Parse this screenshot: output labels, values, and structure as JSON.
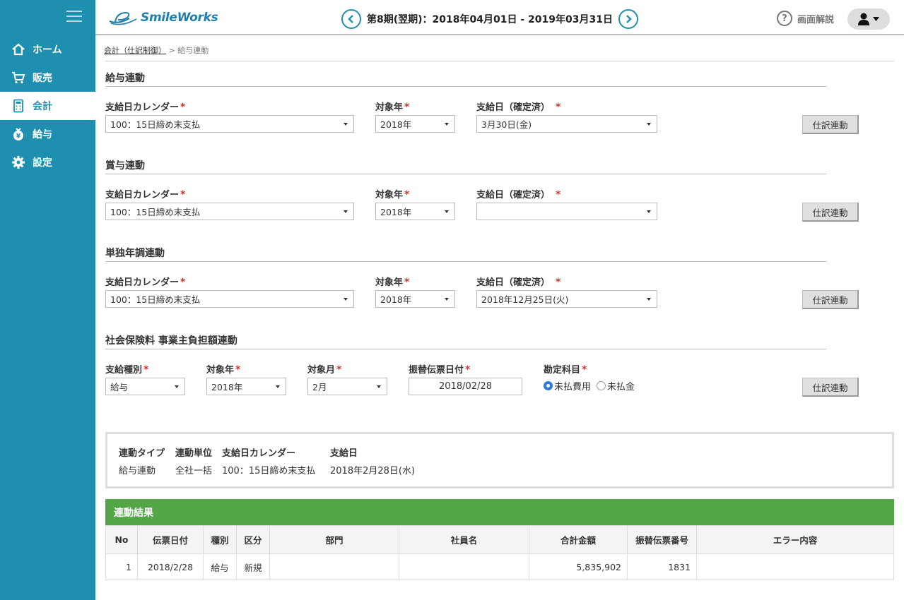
{
  "app": {
    "logo": "SmileWorks"
  },
  "header": {
    "period": "第8期(翌期)：2018年04月01日 - 2019年03月31日",
    "help": "画面解説"
  },
  "sidebar": {
    "items": [
      {
        "label": "ホーム",
        "icon": "home-icon"
      },
      {
        "label": "販売",
        "icon": "cart-icon"
      },
      {
        "label": "会計",
        "icon": "calculator-icon"
      },
      {
        "label": "給与",
        "icon": "money-bag-icon"
      },
      {
        "label": "設定",
        "icon": "gear-icon"
      }
    ]
  },
  "breadcrumb": {
    "parent": "会計（仕訳制御）",
    "sep": ">",
    "current": "給与連動"
  },
  "sections": [
    {
      "title": "給与連動",
      "calendar_label": "支給日カレンダー",
      "calendar_value": "100：15日締め末支払",
      "year_label": "対象年",
      "year_value": "2018年",
      "date_label": "支給日（確定済）",
      "date_value": "3月30日(金)",
      "button": "仕訳連動"
    },
    {
      "title": "賞与連動",
      "calendar_label": "支給日カレンダー",
      "calendar_value": "100：15日締め末支払",
      "year_label": "対象年",
      "year_value": "2018年",
      "date_label": "支給日（確定済）",
      "date_value": "",
      "button": "仕訳連動"
    },
    {
      "title": "単独年調連動",
      "calendar_label": "支給日カレンダー",
      "calendar_value": "100：15日締め末支払",
      "year_label": "対象年",
      "year_value": "2018年",
      "date_label": "支給日（確定済）",
      "date_value": "2018年12月25日(火)",
      "button": "仕訳連動"
    }
  ],
  "social": {
    "title": "社会保険料 事業主負担額連動",
    "type_label": "支給種別",
    "type_value": "給与",
    "year_label": "対象年",
    "year_value": "2018年",
    "month_label": "対象月",
    "month_value": "2月",
    "voucher_label": "振替伝票日付",
    "voucher_value": "2018/02/28",
    "account_label": "勘定科目",
    "radio1": "未払費用",
    "radio2": "未払金",
    "button": "仕訳連動"
  },
  "summary": {
    "cols": [
      {
        "h": "連動タイプ",
        "v": "給与連動"
      },
      {
        "h": "連動単位",
        "v": "全社一括"
      },
      {
        "h": "支給日カレンダー",
        "v": "100：15日締め末支払"
      },
      {
        "h": "支給日",
        "v": "2018年2月28日(水)"
      }
    ]
  },
  "results": {
    "title": "連動結果",
    "headers": [
      "No",
      "伝票日付",
      "種別",
      "区分",
      "部門",
      "社員名",
      "合計金額",
      "振替伝票番号",
      "エラー内容"
    ],
    "rows": [
      [
        "1",
        "2018/2/28",
        "給与",
        "新規",
        "",
        "",
        "5,835,902",
        "1831",
        ""
      ]
    ]
  },
  "colors": {
    "sidebar": "#1e8fae",
    "result_bar": "#53a548",
    "required": "#d0382c"
  }
}
